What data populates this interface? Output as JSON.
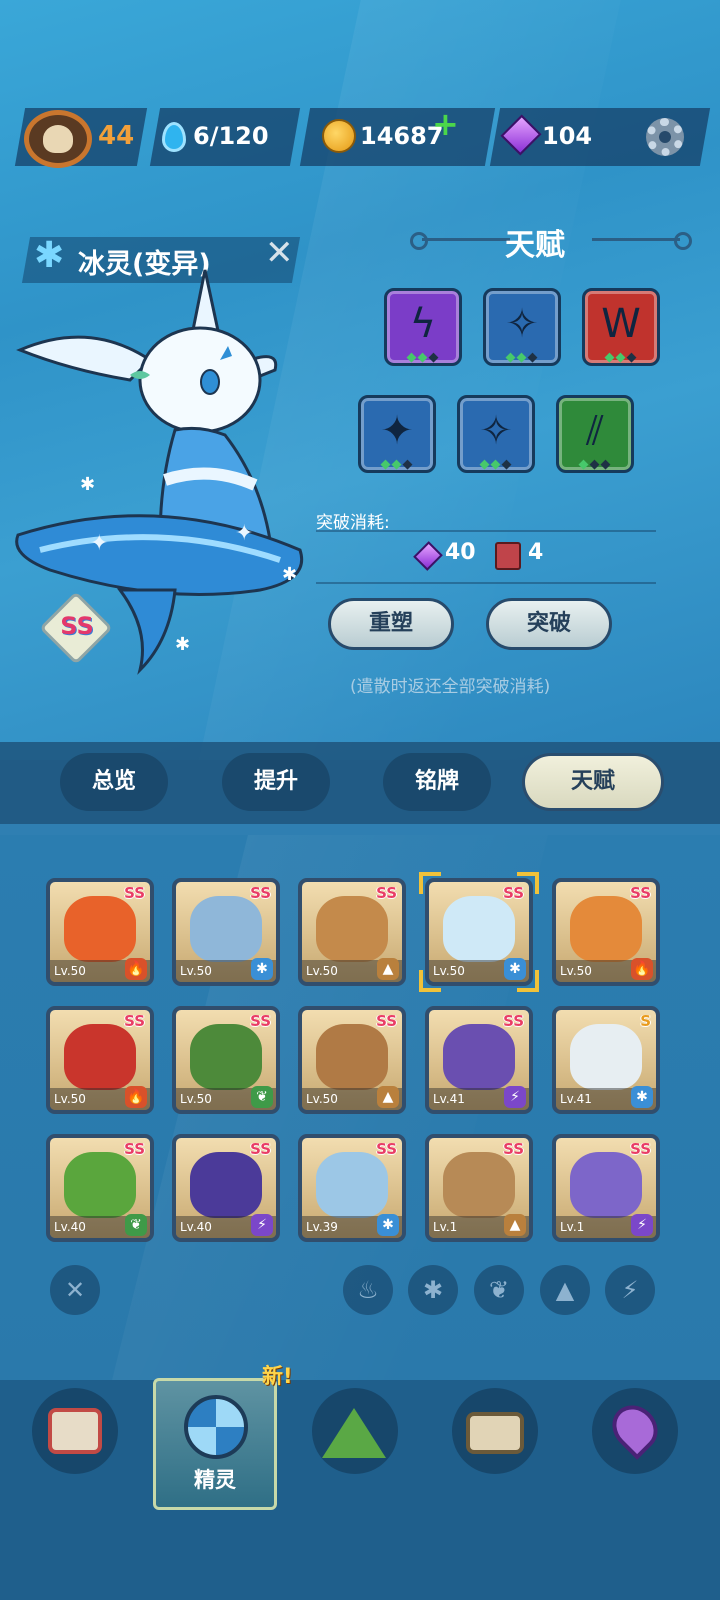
{
  "topbar": {
    "level": "44",
    "stamina": "6/120",
    "coins": "14687",
    "gems": "104",
    "icons": [
      "player-avatar",
      "water-drop-icon",
      "coin-icon",
      "plus-icon",
      "gem-icon",
      "gear-icon"
    ]
  },
  "spirit": {
    "name": "冰灵(变异)",
    "grade": "SS",
    "element_icon": "snowflake-icon"
  },
  "talent_panel": {
    "title": "天赋",
    "talents": [
      {
        "icon": "lightning-icon",
        "color": "#7b3dc8",
        "level": 2,
        "max": 3
      },
      {
        "icon": "ice-spike-icon",
        "color": "#2a6ab0",
        "level": 2,
        "max": 3
      },
      {
        "icon": "fang-icon",
        "color": "#c0332d",
        "level": 2,
        "max": 3
      },
      {
        "icon": "ice-star-icon",
        "color": "#2a6ab0",
        "level": 2,
        "max": 3
      },
      {
        "icon": "ice-spike-icon",
        "color": "#2a6ab0",
        "level": 2,
        "max": 3
      },
      {
        "icon": "claw-icon",
        "color": "#2f8a3a",
        "level": 1,
        "max": 3
      }
    ],
    "cost_label": "突破消耗:",
    "cost_gems": "40",
    "cost_books": "4",
    "reset_label": "重塑",
    "breakthrough_label": "突破",
    "note": "(遣散时返还全部突破消耗)"
  },
  "tabs": [
    {
      "label": "总览",
      "active": false
    },
    {
      "label": "提升",
      "active": false
    },
    {
      "label": "铭牌",
      "active": false
    },
    {
      "label": "天赋",
      "active": true
    }
  ],
  "spirits": [
    {
      "grade": "SS",
      "level": "Lv.50",
      "element": "fire",
      "color": "#e8622a"
    },
    {
      "grade": "SS",
      "level": "Lv.50",
      "element": "ice",
      "color": "#8fb7d9"
    },
    {
      "grade": "SS",
      "level": "Lv.50",
      "element": "earth",
      "color": "#c48a4b"
    },
    {
      "grade": "SS",
      "level": "Lv.50",
      "element": "ice",
      "color": "#cfe9f7"
    },
    {
      "grade": "SS",
      "level": "Lv.50",
      "element": "fire",
      "color": "#e48a3a"
    },
    {
      "grade": "SS",
      "level": "Lv.50",
      "element": "fire",
      "color": "#c9352c"
    },
    {
      "grade": "SS",
      "level": "Lv.50",
      "element": "grass",
      "color": "#4d8a3a"
    },
    {
      "grade": "SS",
      "level": "Lv.50",
      "element": "earth",
      "color": "#b07a45"
    },
    {
      "grade": "SS",
      "level": "Lv.41",
      "element": "lightning",
      "color": "#6a4fb0"
    },
    {
      "grade": "S",
      "level": "Lv.41",
      "element": "ice",
      "color": "#e7eef2"
    },
    {
      "grade": "SS",
      "level": "Lv.40",
      "element": "grass",
      "color": "#5aa63d"
    },
    {
      "grade": "SS",
      "level": "Lv.40",
      "element": "lightning",
      "color": "#4b3a99"
    },
    {
      "grade": "SS",
      "level": "Lv.39",
      "element": "ice",
      "color": "#9cc7e6"
    },
    {
      "grade": "SS",
      "level": "Lv.1",
      "element": "earth",
      "color": "#b78a56"
    },
    {
      "grade": "SS",
      "level": "Lv.1",
      "element": "lightning",
      "color": "#7d66c9"
    }
  ],
  "element_styles": {
    "fire": {
      "glyph": "🔥",
      "bg": "#d9512a"
    },
    "ice": {
      "glyph": "✱",
      "bg": "#3a8fd6"
    },
    "earth": {
      "glyph": "▲",
      "bg": "#b9803d"
    },
    "grass": {
      "glyph": "❦",
      "bg": "#3f9a48"
    },
    "lightning": {
      "glyph": "⚡",
      "bg": "#7b47c9"
    }
  },
  "filters": [
    "close-filter-icon",
    "fire-filter-icon",
    "ice-filter-icon",
    "grass-filter-icon",
    "earth-filter-icon",
    "lightning-filter-icon"
  ],
  "nav": {
    "active_label": "精灵",
    "new_badge": "新!",
    "items": [
      "device-icon",
      "spirit-icon",
      "mountain-icon",
      "chest-icon",
      "map-pin-icon"
    ]
  }
}
